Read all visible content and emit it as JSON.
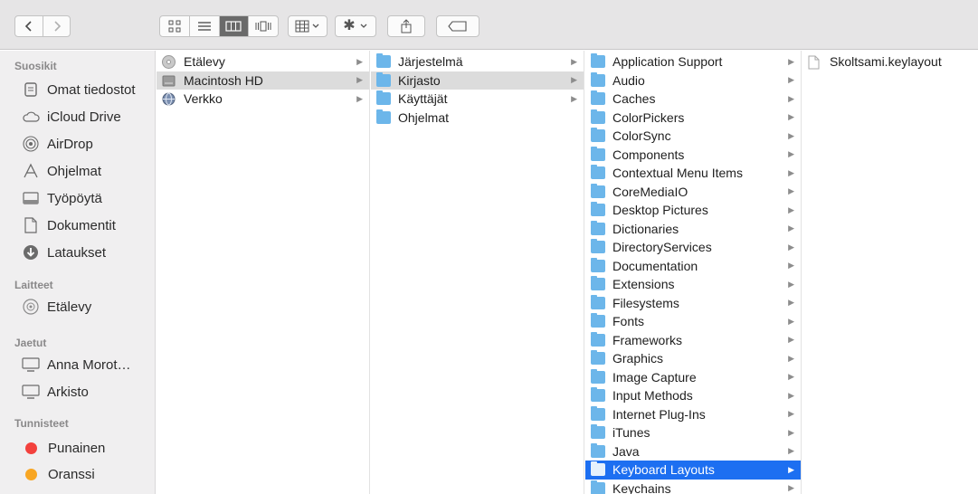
{
  "toolbar": {
    "back_label": "<",
    "forward_label": ">"
  },
  "sidebar": {
    "sections": [
      {
        "title": "Suosikit",
        "items": [
          "Omat tiedostot",
          "iCloud Drive",
          "AirDrop",
          "Ohjelmat",
          "Työpöytä",
          "Dokumentit",
          "Lataukset"
        ]
      },
      {
        "title": "Laitteet",
        "items": [
          "Etälevy"
        ]
      },
      {
        "title": "Jaetut",
        "items": [
          "Anna Morot…",
          "Arkisto"
        ]
      },
      {
        "title": "Tunnisteet",
        "items": [
          "Punainen",
          "Oranssi"
        ]
      }
    ],
    "tag_colors": {
      "Punainen": "#f3413d",
      "Oranssi": "#f8a623"
    }
  },
  "columns": [
    {
      "items": [
        "Etälevy",
        "Macintosh HD",
        "Verkko"
      ],
      "selected": "Macintosh HD"
    },
    {
      "items": [
        "Järjestelmä",
        "Kirjasto",
        "Käyttäjät",
        "Ohjelmat"
      ],
      "selected": "Kirjasto"
    },
    {
      "items": [
        "Application Support",
        "Audio",
        "Caches",
        "ColorPickers",
        "ColorSync",
        "Components",
        "Contextual Menu Items",
        "CoreMediaIO",
        "Desktop Pictures",
        "Dictionaries",
        "DirectoryServices",
        "Documentation",
        "Extensions",
        "Filesystems",
        "Fonts",
        "Frameworks",
        "Graphics",
        "Image Capture",
        "Input Methods",
        "Internet Plug-Ins",
        "iTunes",
        "Java",
        "Keyboard Layouts",
        "Keychains"
      ],
      "selected": "Keyboard Layouts"
    },
    {
      "items": [
        "Skoltsami.keylayout"
      ]
    }
  ],
  "colors": {
    "selection_active": "#1d6ff1",
    "selection_inactive": "#dcdcdc",
    "folder": "#6cb6ea"
  }
}
